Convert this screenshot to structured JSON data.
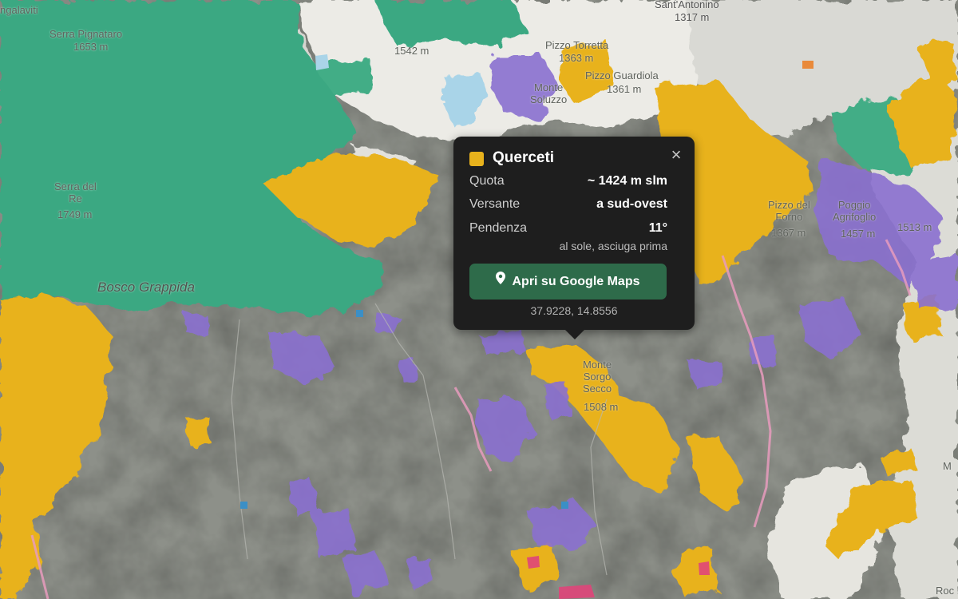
{
  "map": {
    "labels": [
      {
        "id": "angalaviti",
        "text": "ngalaviti"
      },
      {
        "id": "serra-pignataro",
        "text": "Serra Pignataro"
      },
      {
        "id": "serra-pignataro-elev",
        "text": "1653 m"
      },
      {
        "id": "elev-1542",
        "text": "1542 m"
      },
      {
        "id": "sant-antonino",
        "text": "Sant'Antonino"
      },
      {
        "id": "sant-antonino-elev",
        "text": "1317 m"
      },
      {
        "id": "pizzo-torretta",
        "text": "Pizzo Torretta"
      },
      {
        "id": "pizzo-torretta-elev",
        "text": "1363 m"
      },
      {
        "id": "pizzo-guardiola",
        "text": "Pizzo Guardiola"
      },
      {
        "id": "pizzo-guardiola-elev",
        "text": "1361 m"
      },
      {
        "id": "monte-soluzzo",
        "text": "Monte\nSoluzzo"
      },
      {
        "id": "serra-del-re",
        "text": "Serra del\nRe"
      },
      {
        "id": "serra-del-re-elev",
        "text": "1749 m"
      },
      {
        "id": "pizzo-del-forno",
        "text": "Pizzo del\nForno"
      },
      {
        "id": "pizzo-del-forno-elev",
        "text": "1367 m"
      },
      {
        "id": "poggio-agrifoglio",
        "text": "Poggio\nAgrifoglio"
      },
      {
        "id": "poggio-agrifoglio-elev",
        "text": "1457 m"
      },
      {
        "id": "elev-1513",
        "text": "1513 m"
      },
      {
        "id": "bosco-grappida",
        "text": "Bosco Grappida"
      },
      {
        "id": "monte-sorgo-secco",
        "text": "Monte\nSorgo\nSecco"
      },
      {
        "id": "monte-sorgo-secco-elev",
        "text": "1508 m"
      },
      {
        "id": "edge-mo",
        "text": "M"
      },
      {
        "id": "edge-roc",
        "text": "Roc"
      }
    ]
  },
  "popup": {
    "title": "Querceti",
    "swatch_color": "#e8b21c",
    "close_symbol": "×",
    "rows": [
      {
        "key": "Quota",
        "value": "~ 1424 m slm"
      },
      {
        "key": "Versante",
        "value": "a sud-ovest"
      },
      {
        "key": "Pendenza",
        "value": "11°"
      }
    ],
    "note": "al sole, asciuga prima",
    "button_label": "Apri su Google Maps",
    "coordinates": "37.9228, 14.8556"
  },
  "colors": {
    "beech_green": "#3aa882",
    "oak_yellow": "#e8b21c",
    "purple": "#8a6fd0",
    "terrain": "#8d9089",
    "snow": "#eeeeea",
    "button_green": "#2e6b4a"
  }
}
